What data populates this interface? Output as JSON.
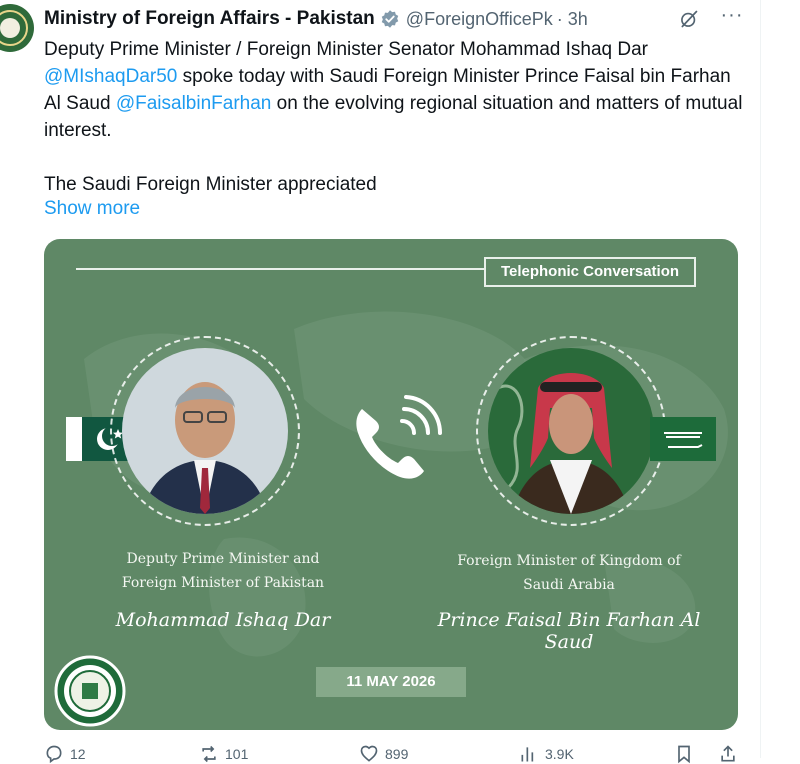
{
  "account": {
    "name": "Ministry of Foreign Affairs - Pakistan",
    "handle": "@ForeignOfficePk",
    "time": "· 3h",
    "more_label": "···"
  },
  "tweet": {
    "part1": "Deputy Prime Minister / Foreign Minister Senator Mohammad Ishaq Dar ",
    "mention1": "@MIshaqDar50",
    "part2": " spoke today with Saudi Foreign Minister Prince Faisal bin Farhan Al Saud ",
    "mention2": "@FaisalbinFarhan",
    "part3": " on the evolving regional situation and matters of mutual interest.",
    "para2": "The Saudi Foreign Minister appreciated",
    "show_more": "Show more"
  },
  "card": {
    "heading": "Telephonic Conversation",
    "left_caption_line1": "Deputy Prime Minister and",
    "left_caption_line2": "Foreign Minister of Pakistan",
    "left_name": "Mohammad Ishaq Dar",
    "right_caption_line1": "Foreign Minister of Kingdom of",
    "right_caption_line2": "Saudi Arabia",
    "right_name_line1": "Prince Faisal Bin Farhan Al",
    "right_name_line2": "Saud",
    "date": "11 MAY 2026"
  },
  "actions": {
    "reply": "12",
    "repost": "101",
    "like": "899",
    "views": "3.9K"
  },
  "icons": [
    "verified-badge-icon",
    "grok-icon",
    "more-icon",
    "phone-icon",
    "reply-icon",
    "repost-icon",
    "like-icon",
    "views-icon",
    "bookmark-icon",
    "share-icon"
  ],
  "colors": {
    "card_green": "#5f8866",
    "link_blue": "#1d9bf0",
    "muted": "#536471"
  }
}
